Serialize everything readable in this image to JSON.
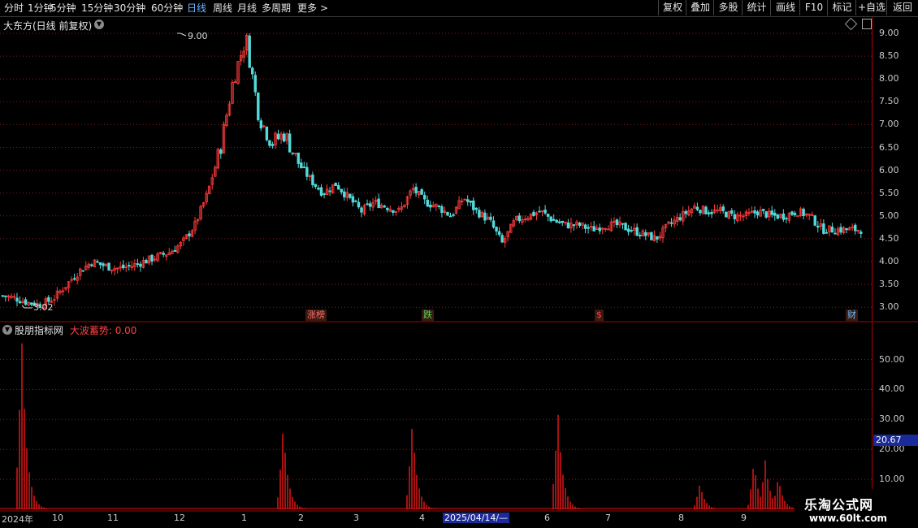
{
  "toolbar": {
    "tabs": [
      {
        "label": "分时"
      },
      {
        "label": "1分钟"
      },
      {
        "label": "5分钟"
      },
      {
        "label": "15分钟"
      },
      {
        "label": "30分钟"
      },
      {
        "label": "60分钟"
      },
      {
        "label": "日线",
        "active": true
      },
      {
        "label": "周线"
      },
      {
        "label": "月线"
      },
      {
        "label": "多周期"
      },
      {
        "label": "更多 >"
      }
    ],
    "right_buttons": [
      {
        "label": "复权"
      },
      {
        "label": "叠加"
      },
      {
        "label": "多股"
      },
      {
        "label": "统计"
      },
      {
        "label": "画线"
      },
      {
        "label": "F10"
      },
      {
        "label": "标记"
      },
      {
        "label": "+自选"
      },
      {
        "label": "返回"
      }
    ]
  },
  "main_panel": {
    "title": "大东方(日线 前复权)",
    "high_label": "9.00",
    "low_label": "3.02",
    "y_ticks": [
      "9.00",
      "8.50",
      "8.00",
      "7.50",
      "7.00",
      "6.50",
      "6.00",
      "5.50",
      "5.00",
      "4.50",
      "4.00",
      "3.50",
      "3.00"
    ],
    "events": [
      {
        "label": "涨榜",
        "color": "#ff7070"
      },
      {
        "label": "跌",
        "color": "#55dd55"
      },
      {
        "label": "$",
        "color": "#ff4040"
      },
      {
        "label": "财",
        "color": "#66bbff"
      }
    ]
  },
  "indicator_panel": {
    "name": "股朋指标网",
    "line_label": "大波蓄势:",
    "line_value": "0.00",
    "y_ticks": [
      "50.00",
      "40.00",
      "30.00",
      "20.00",
      "10.00"
    ],
    "current_value": "20.67"
  },
  "x_axis": {
    "labels": [
      "2024年",
      "10",
      "11",
      "12",
      "1",
      "2",
      "3",
      "4",
      "2025/04/14/—",
      "6",
      "7",
      "8",
      "9"
    ]
  },
  "watermark": {
    "title": "乐淘公式网",
    "url": "www.60lt.com"
  },
  "chart_data": [
    {
      "type": "candlestick",
      "title": "大东方(日线 前复权)",
      "ylim": [
        2.85,
        9.15
      ],
      "max_label": 9.0,
      "min_label": 3.02,
      "close_path": [
        3.25,
        3.2,
        3.1,
        3.05,
        3.2,
        3.5,
        3.8,
        4.0,
        3.9,
        3.85,
        3.9,
        4.0,
        4.1,
        4.2,
        4.4,
        4.8,
        5.5,
        6.5,
        8.0,
        8.9,
        7.2,
        6.6,
        6.8,
        6.2,
        5.8,
        5.5,
        5.7,
        5.4,
        5.1,
        5.3,
        5.2,
        5.1,
        5.6,
        5.3,
        5.2,
        5.0,
        5.4,
        5.1,
        4.9,
        4.4,
        4.9,
        5.0,
        5.1,
        4.9,
        4.8,
        4.8,
        4.7,
        4.8,
        4.8,
        4.7,
        4.6,
        4.5,
        4.8,
        5.0,
        5.2,
        5.1,
        5.1,
        5.0,
        5.0,
        5.1,
        5.0,
        5.0,
        5.1,
        5.0,
        4.7,
        4.7,
        4.7,
        4.7
      ]
    },
    {
      "type": "bar",
      "title": "大波蓄势",
      "ylim": [
        0,
        60
      ],
      "current_value": 20.67,
      "peaks": [
        {
          "position": 0.025,
          "value": 57
        },
        {
          "position": 0.325,
          "value": 27.5
        },
        {
          "position": 0.473,
          "value": 28.5
        },
        {
          "position": 0.64,
          "value": 33
        },
        {
          "position": 0.803,
          "value": 8.5
        },
        {
          "position": 0.865,
          "value": 15.5
        },
        {
          "position": 0.878,
          "value": 16.5
        },
        {
          "position": 0.893,
          "value": 10.5
        }
      ]
    }
  ],
  "colors": {
    "up": "#ff3b3b",
    "down": "#53d9d9",
    "grid": "#8a1a1a",
    "axis": "#b00000",
    "indicator_bar": "#d41414",
    "active_tab": "#6fb7ff"
  }
}
